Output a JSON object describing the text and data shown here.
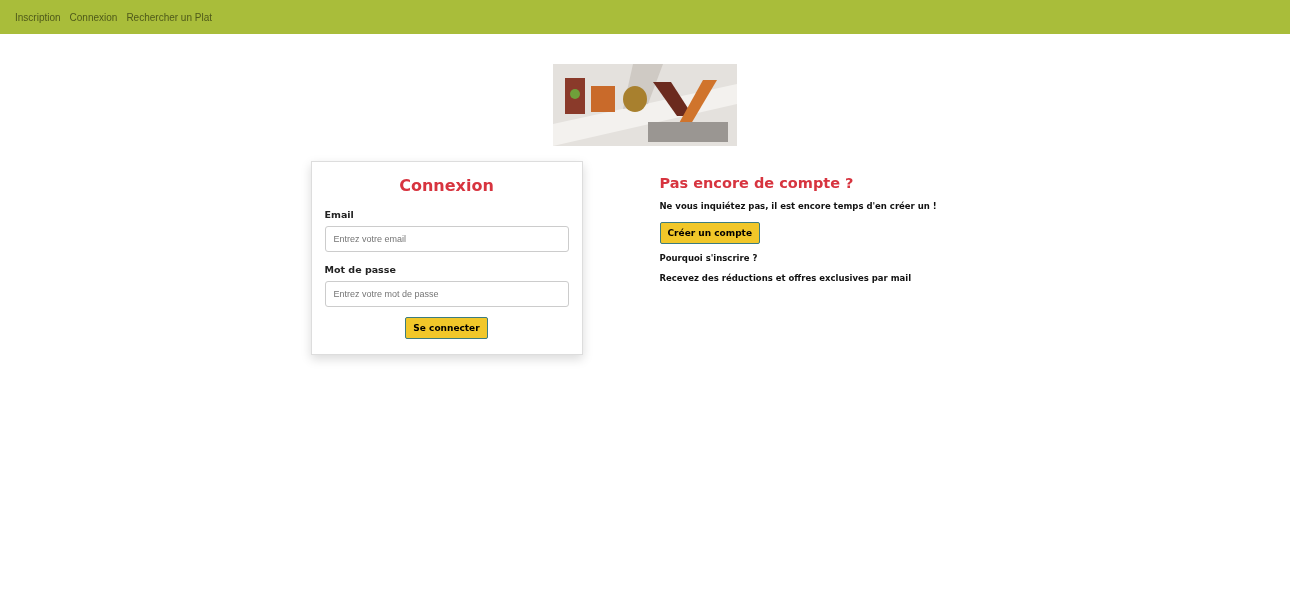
{
  "nav": {
    "links": [
      "Inscription",
      "Connexion",
      "Rechercher un Plat"
    ]
  },
  "login": {
    "title": "Connexion",
    "fields": [
      {
        "label": "Email",
        "placeholder": "Entrez votre email"
      },
      {
        "label": "Mot de passe",
        "placeholder": "Entrez votre mot de passe"
      }
    ],
    "button": "Se connecter"
  },
  "signup": {
    "title": "Pas encore de compte ?",
    "text": "Ne vous inquiétez pas, il est encore temps d'en créer un !",
    "button": "Créer un compte",
    "question": "Pourquoi s'inscrire ?",
    "answer": "Recevez des réductions et offres exclusives par mail"
  }
}
